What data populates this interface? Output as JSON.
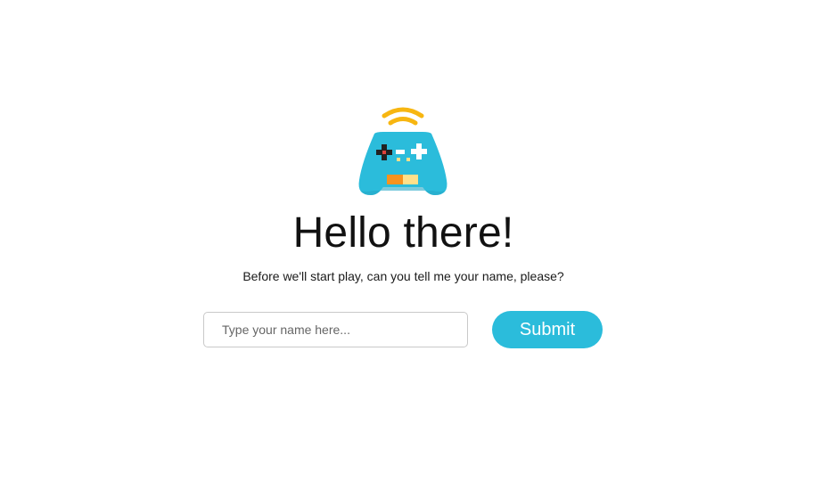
{
  "logo": {
    "icon": "gamepad-wifi-icon",
    "colors": {
      "body": "#2bbcdb",
      "signal": "#f7b611",
      "dpad": "#222222",
      "dpad_center": "#e0433b",
      "buttons": "#ffffff",
      "accent_orange": "#f7931e",
      "accent_yellow": "#ffe08a"
    }
  },
  "heading": {
    "title": "Hello there!",
    "subtitle": "Before we'll start play, can you tell me your name, please?"
  },
  "form": {
    "name_placeholder": "Type your name here...",
    "name_value": "",
    "submit_label": "Submit"
  },
  "theme": {
    "accent": "#2bbcdb",
    "background": "#ffffff"
  }
}
